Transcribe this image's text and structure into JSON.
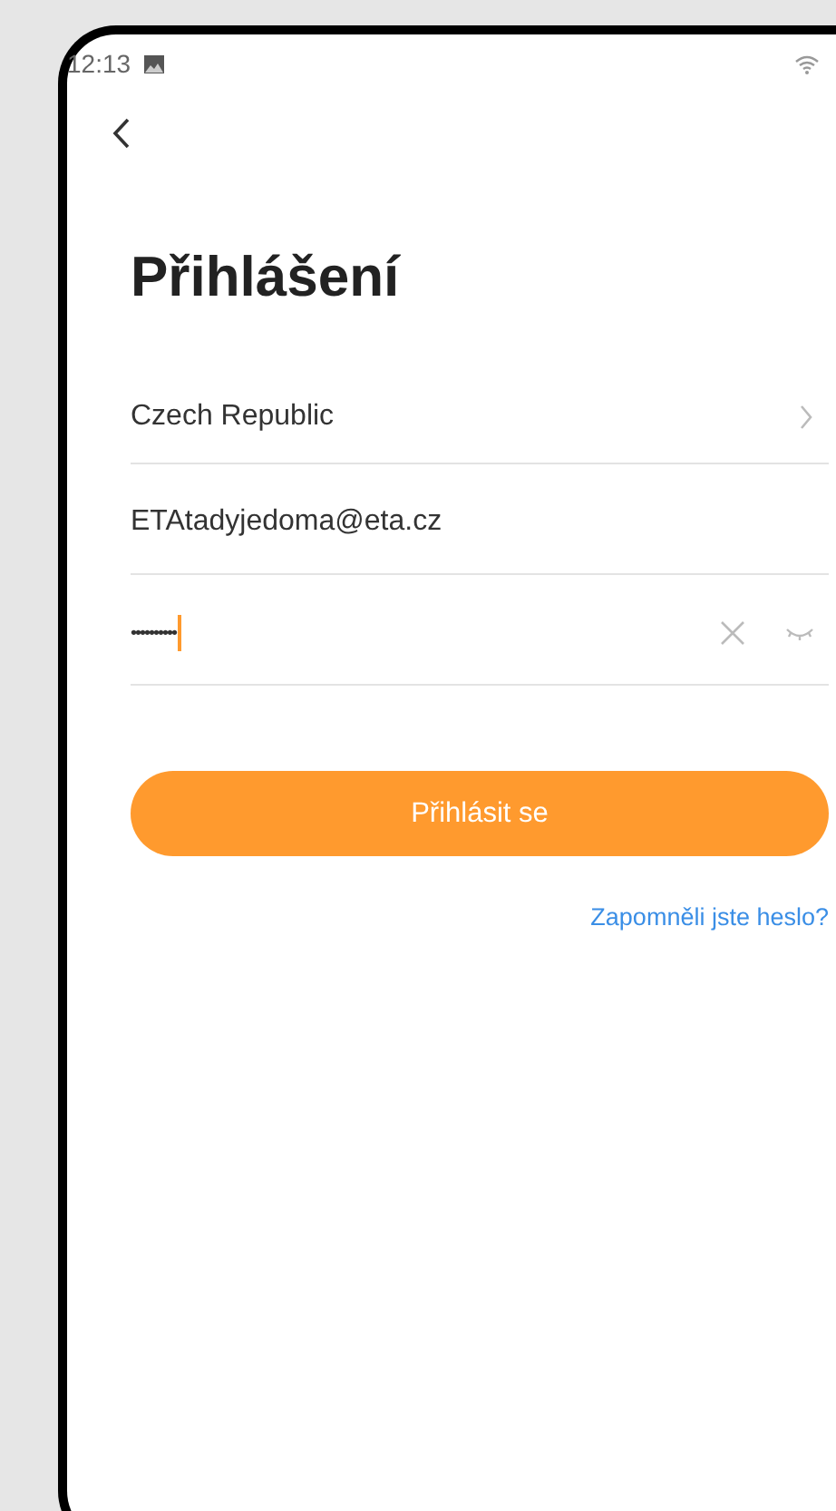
{
  "status_bar": {
    "time": "12:13"
  },
  "title": "Přihlášení",
  "fields": [
    {
      "kind": "select",
      "value": "Czech Republic"
    },
    {
      "kind": "text",
      "value": "ETAtadyjedoma@eta.cz"
    },
    {
      "kind": "password",
      "value": "••••••••••",
      "focused": true
    }
  ],
  "login_button": "Přihlásit se",
  "forgot_link": "Zapomněli jste heslo?"
}
